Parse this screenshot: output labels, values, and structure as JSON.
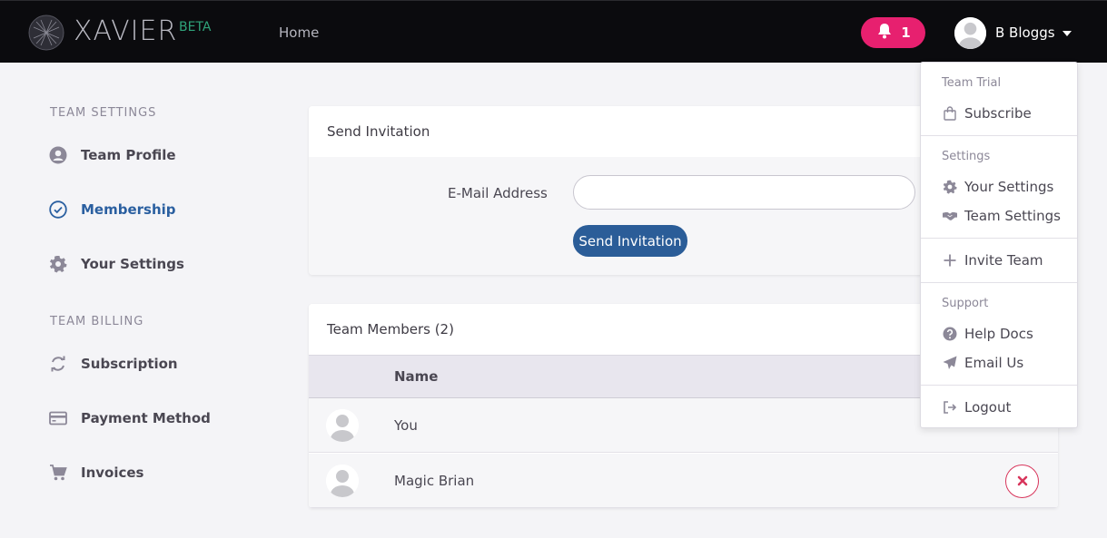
{
  "navbar": {
    "brand": "XAVIER",
    "brand_badge": "BETA",
    "home_label": "Home",
    "notification_count": "1",
    "user_name": "B Bloggs"
  },
  "sidebar": {
    "team_settings_heading": "TEAM SETTINGS",
    "team_billing_heading": "TEAM BILLING",
    "items": [
      {
        "label": "Team Profile",
        "icon": "user-circle-icon"
      },
      {
        "label": "Membership",
        "icon": "check-circle-icon",
        "active": true
      },
      {
        "label": "Your Settings",
        "icon": "gear-icon"
      },
      {
        "label": "Subscription",
        "icon": "sync-icon"
      },
      {
        "label": "Payment Method",
        "icon": "credit-card-icon"
      },
      {
        "label": "Invoices",
        "icon": "cart-icon"
      }
    ]
  },
  "invite": {
    "title": "Send Invitation",
    "email_label": "E-Mail Address",
    "email_value": "",
    "button_label": "Send Invitation"
  },
  "members": {
    "title": "Team Members (2)",
    "column_name": "Name",
    "rows": [
      {
        "name": "You"
      },
      {
        "name": "Magic Brian"
      }
    ]
  },
  "dropdown": {
    "team_trial_heading": "Team Trial",
    "subscribe": "Subscribe",
    "settings_heading": "Settings",
    "your_settings": "Your Settings",
    "team_settings": "Team Settings",
    "invite_team": "Invite Team",
    "support_heading": "Support",
    "help_docs": "Help Docs",
    "email_us": "Email Us",
    "logout": "Logout"
  },
  "colors": {
    "navbar_bg": "#0b0b0e",
    "accent_blue": "#2b5d98",
    "notification_pink": "#e7206f",
    "beta_green": "#2fa37a",
    "danger_red": "#d8365c"
  }
}
